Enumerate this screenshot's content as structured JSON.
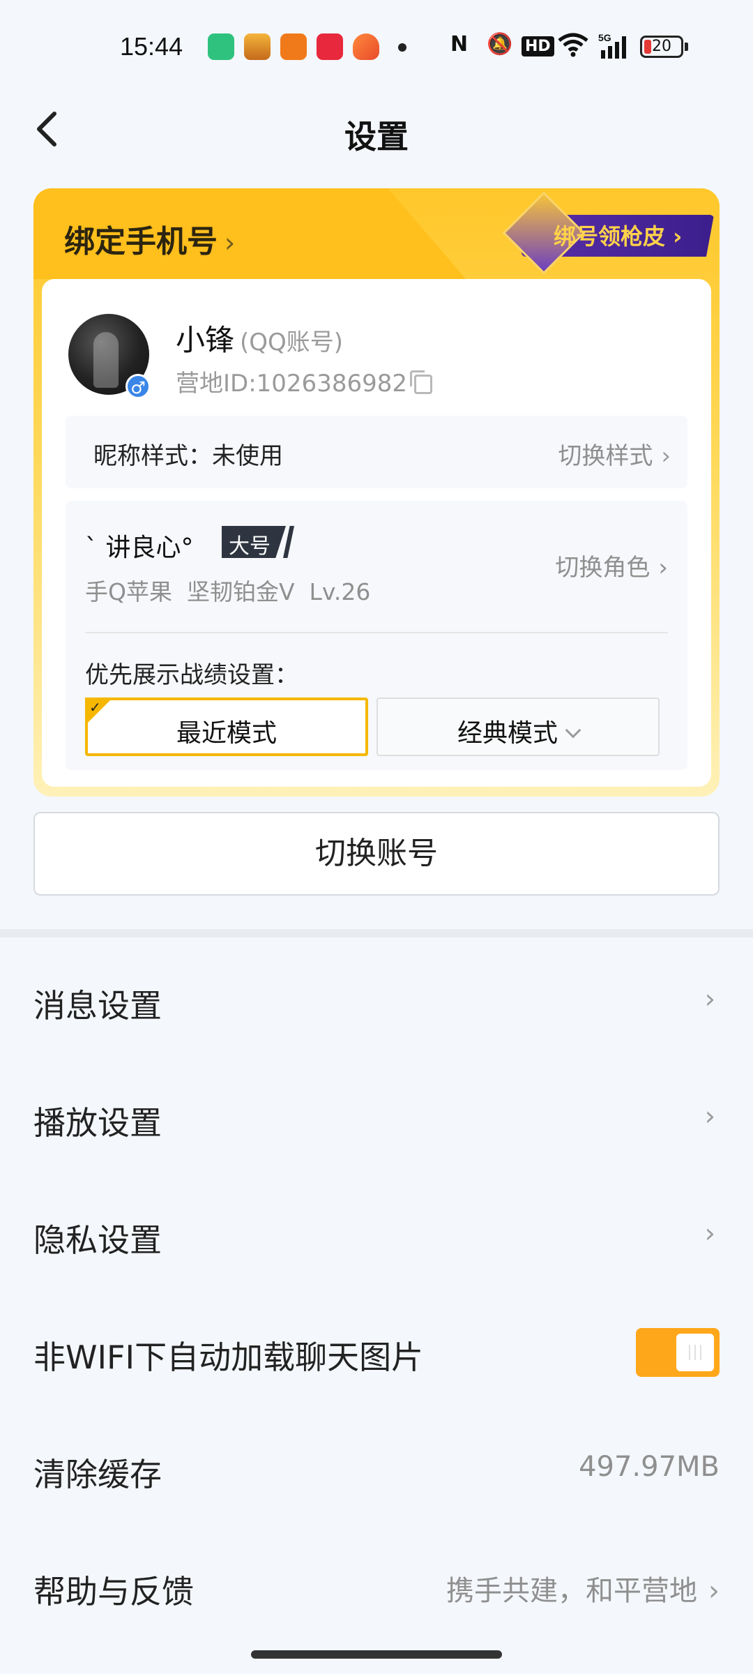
{
  "status_bar": {
    "time": "15:44",
    "icons": [
      "battery-saver-icon",
      "app-icon-1",
      "sogou-icon",
      "music-icon",
      "game-icon",
      "nfc-icon",
      "mute-icon",
      "hd-icon",
      "wifi-icon",
      "5g-signal-icon"
    ],
    "battery_level": "20",
    "battery_color": "#e53935"
  },
  "header": {
    "title": "设置",
    "back_icon": "chevron-left-icon"
  },
  "account_card": {
    "bind_phone_label": "绑定手机号",
    "bind_phone_chevron": "›",
    "promo_label": "绑号领枪皮",
    "promo_chevron": "›",
    "user_name": "小锋",
    "account_type": "(QQ账号)",
    "camp_id": "营地ID:1026386982",
    "gender_symbol": "♂",
    "nickname_style_label": "昵称样式：未使用",
    "switch_style_label": "切换样式",
    "role_name": "` 讲良心°",
    "main_badge": "大号",
    "role_sub": "手Q苹果  坚韧铂金V  Lv.26",
    "switch_role_label": "切换角色",
    "priority_label": "优先展示战绩设置：",
    "mode_recent": "最近模式",
    "mode_classic": "经典模式",
    "accent_color": "#f5b700"
  },
  "switch_account_label": "切换账号",
  "settings": [
    {
      "label": "消息设置",
      "chevron": "›"
    },
    {
      "label": "播放设置",
      "chevron": "›"
    },
    {
      "label": "隐私设置",
      "chevron": "›"
    },
    {
      "label": "非WIFI下自动加载聊天图片",
      "toggle_on": true
    },
    {
      "label": "清除缓存",
      "value": "497.97MB"
    },
    {
      "label": "帮助与反馈",
      "value": "携手共建，和平营地",
      "chevron": "›"
    }
  ],
  "toggle_color": "#ffa71a"
}
